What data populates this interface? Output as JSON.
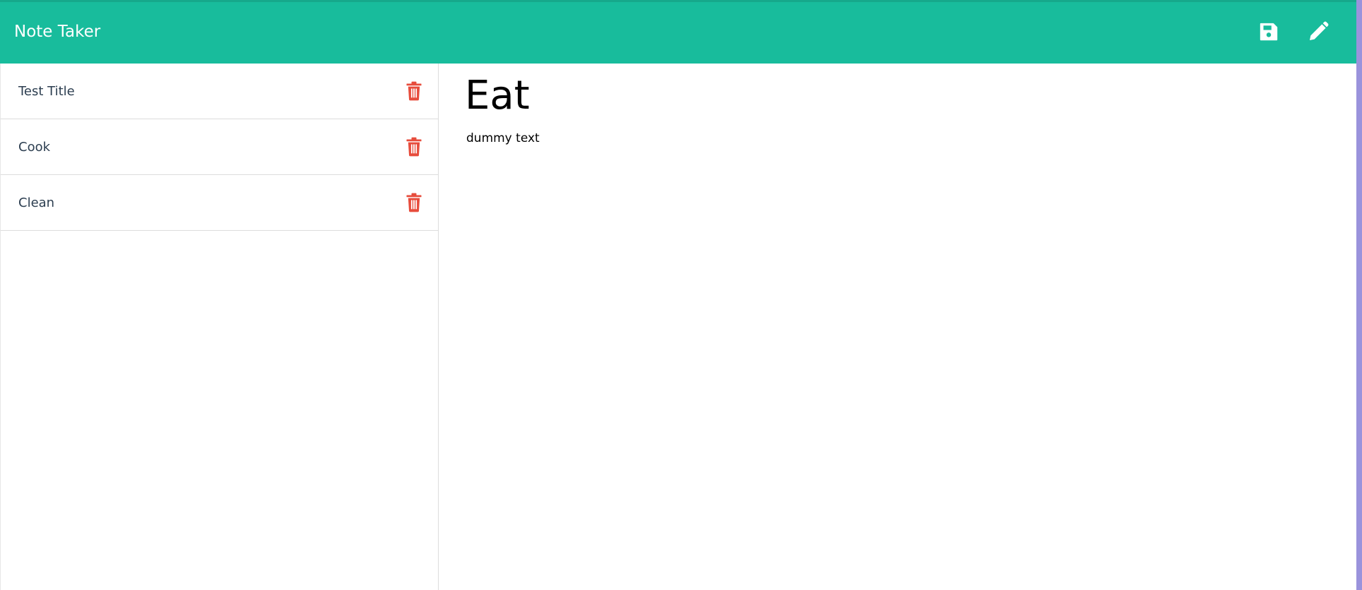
{
  "app": {
    "brand": "Note Taker"
  },
  "toolbar": {
    "save_icon": "save-icon",
    "edit_icon": "pencil-icon"
  },
  "notes": [
    {
      "title": "Test Title",
      "delete_icon": "trash-icon"
    },
    {
      "title": "Cook",
      "delete_icon": "trash-icon"
    },
    {
      "title": "Clean",
      "delete_icon": "trash-icon"
    }
  ],
  "editor": {
    "title_value": "Eat",
    "text_value": "dummy text"
  },
  "colors": {
    "navbar": "#18bc9c",
    "delete": "#e74c3c",
    "text": "#2c3e50",
    "accent_strip": "#9a93dc"
  }
}
